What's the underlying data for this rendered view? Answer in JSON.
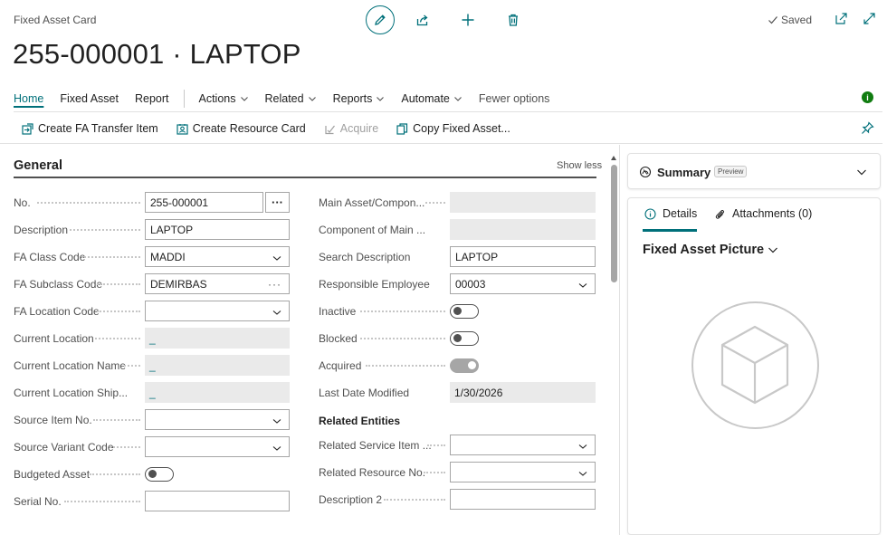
{
  "header": {
    "card_type": "Fixed Asset Card",
    "title": "255-000001 · LAPTOP",
    "saved": "Saved"
  },
  "menu": {
    "items": [
      "Home",
      "Fixed Asset",
      "Report"
    ],
    "dropdowns": [
      "Actions",
      "Related",
      "Reports",
      "Automate"
    ],
    "fewer": "Fewer options"
  },
  "actions": {
    "transfer": "Create FA Transfer Item",
    "resource": "Create Resource Card",
    "acquire": "Acquire",
    "copy": "Copy Fixed Asset..."
  },
  "general": {
    "header": "General",
    "show_less": "Show less",
    "left": [
      {
        "label": "No.",
        "value": "255-000001"
      },
      {
        "label": "Description",
        "value": "LAPTOP"
      },
      {
        "label": "FA Class Code",
        "value": "MADDI"
      },
      {
        "label": "FA Subclass Code",
        "value": "DEMIRBAS"
      },
      {
        "label": "FA Location Code",
        "value": ""
      },
      {
        "label": "Current Location",
        "value": "_"
      },
      {
        "label": "Current Location Name",
        "value": "_"
      },
      {
        "label": "Current Location Ship...",
        "value": "_"
      },
      {
        "label": "Source Item No.",
        "value": ""
      },
      {
        "label": "Source Variant Code",
        "value": ""
      },
      {
        "label": "Budgeted Asset",
        "value": false
      },
      {
        "label": "Serial No.",
        "value": ""
      }
    ],
    "right": [
      {
        "label": "Main Asset/Compon...",
        "value": ""
      },
      {
        "label": "Component of Main ...",
        "value": ""
      },
      {
        "label": "Search Description",
        "value": "LAPTOP"
      },
      {
        "label": "Responsible Employee",
        "value": "00003"
      },
      {
        "label": "Inactive",
        "value": false
      },
      {
        "label": "Blocked",
        "value": false
      },
      {
        "label": "Acquired",
        "value": true
      },
      {
        "label": "Last Date Modified",
        "value": "1/30/2026"
      }
    ],
    "related_header": "Related Entities",
    "related": [
      {
        "label": "Related Service Item ...",
        "value": ""
      },
      {
        "label": "Related Resource No.",
        "value": ""
      },
      {
        "label": "Description 2",
        "value": ""
      }
    ]
  },
  "factbox": {
    "summary": "Summary",
    "preview": "Preview",
    "tab_details": "Details",
    "tab_attachments": "Attachments (0)",
    "picture_title": "Fixed Asset Picture"
  },
  "colors": {
    "accent": "#00707a",
    "info": "#107c10"
  }
}
